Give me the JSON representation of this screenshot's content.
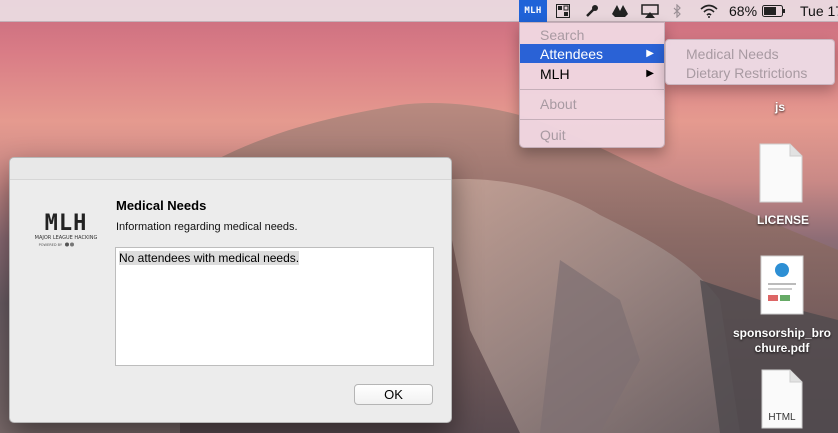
{
  "menubar": {
    "extra_label": "MLH",
    "battery_percent": "68%",
    "clock": "Tue 17",
    "icons": [
      "mlh-extra-icon",
      "grid-icon",
      "wrench-icon",
      "drive-icon",
      "airplay-icon",
      "bluetooth-icon",
      "wifi-icon",
      "battery-icon"
    ]
  },
  "menu": {
    "items": [
      {
        "label": "Search"
      },
      {
        "label": "Attendees",
        "arrow": "▶"
      },
      {
        "label": "MLH",
        "arrow": "▶"
      },
      {
        "label": "About"
      },
      {
        "label": "Quit"
      }
    ]
  },
  "submenu": {
    "items": [
      {
        "label": "Medical Needs"
      },
      {
        "label": "Dietary Restrictions"
      }
    ]
  },
  "desktop": {
    "items": [
      {
        "label": "js"
      },
      {
        "label": "LICENSE"
      },
      {
        "label_line1": "sponsorship_bro",
        "label_line2": "chure.pdf"
      },
      {
        "badge": "HTML"
      }
    ]
  },
  "dialog": {
    "logo_text": "MLH",
    "logo_sub": "MAJOR LEAGUE HACKING",
    "logo_powered": "POWERED BY",
    "title": "Medical Needs",
    "subtitle": "Information regarding medical needs.",
    "body": "No attendees with medical needs.",
    "ok_label": "OK"
  }
}
